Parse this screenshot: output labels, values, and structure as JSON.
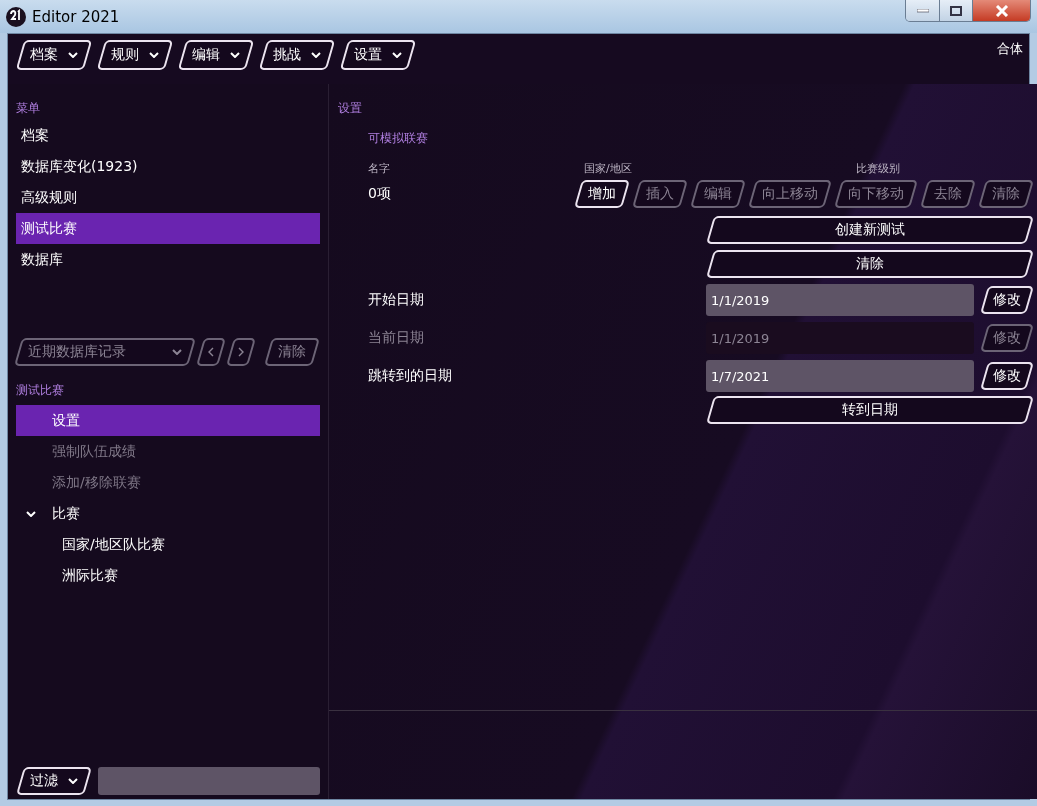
{
  "window": {
    "title": "Editor 2021"
  },
  "menubar": {
    "menus": [
      {
        "label": "档案"
      },
      {
        "label": "规则"
      },
      {
        "label": "编辑"
      },
      {
        "label": "挑战"
      },
      {
        "label": "设置"
      }
    ],
    "mode": "合体"
  },
  "sidebar": {
    "heading": "菜单",
    "items": [
      {
        "label": "档案",
        "selected": false
      },
      {
        "label": "数据库变化(1923)",
        "selected": false
      },
      {
        "label": "高级规则",
        "selected": false
      },
      {
        "label": "测试比赛",
        "selected": true
      },
      {
        "label": "数据库",
        "selected": false
      }
    ],
    "recent": {
      "placeholder": "近期数据库记录",
      "disabled": true,
      "clear": "清除"
    },
    "section": {
      "heading": "测试比赛",
      "items": [
        {
          "label": "设置",
          "selected": true,
          "disabled": false
        },
        {
          "label": "强制队伍成绩",
          "selected": false,
          "disabled": true
        },
        {
          "label": "添加/移除联赛",
          "selected": false,
          "disabled": true
        },
        {
          "label": "比赛",
          "selected": false,
          "disabled": false,
          "expanded": true,
          "children": [
            {
              "label": "国家/地区队比赛",
              "selected": false,
              "disabled": false
            },
            {
              "label": "洲际比赛",
              "selected": false,
              "disabled": false
            }
          ]
        }
      ]
    },
    "filter": {
      "label": "过滤"
    }
  },
  "main": {
    "heading": "设置",
    "leagues": {
      "title": "可模拟联赛",
      "columns": [
        "名字",
        "国家/地区",
        "比赛级别"
      ],
      "count": "0项",
      "actions": [
        {
          "label": "增加",
          "disabled": false
        },
        {
          "label": "插入",
          "disabled": true
        },
        {
          "label": "编辑",
          "disabled": true
        },
        {
          "label": "向上移动",
          "disabled": true
        },
        {
          "label": "向下移动",
          "disabled": true
        },
        {
          "label": "去除",
          "disabled": true
        },
        {
          "label": "清除",
          "disabled": true
        }
      ]
    },
    "wide_buttons": [
      "创建新测试",
      "清除"
    ],
    "dates": [
      {
        "label": "开始日期",
        "value": "1/1/2019",
        "button": "修改",
        "disabled": false
      },
      {
        "label": "当前日期",
        "value": "1/1/2019",
        "button": "修改",
        "disabled": true
      },
      {
        "label": "跳转到的日期",
        "value": "1/7/2021",
        "button": "修改",
        "disabled": false
      }
    ],
    "goto_button": "转到日期"
  }
}
